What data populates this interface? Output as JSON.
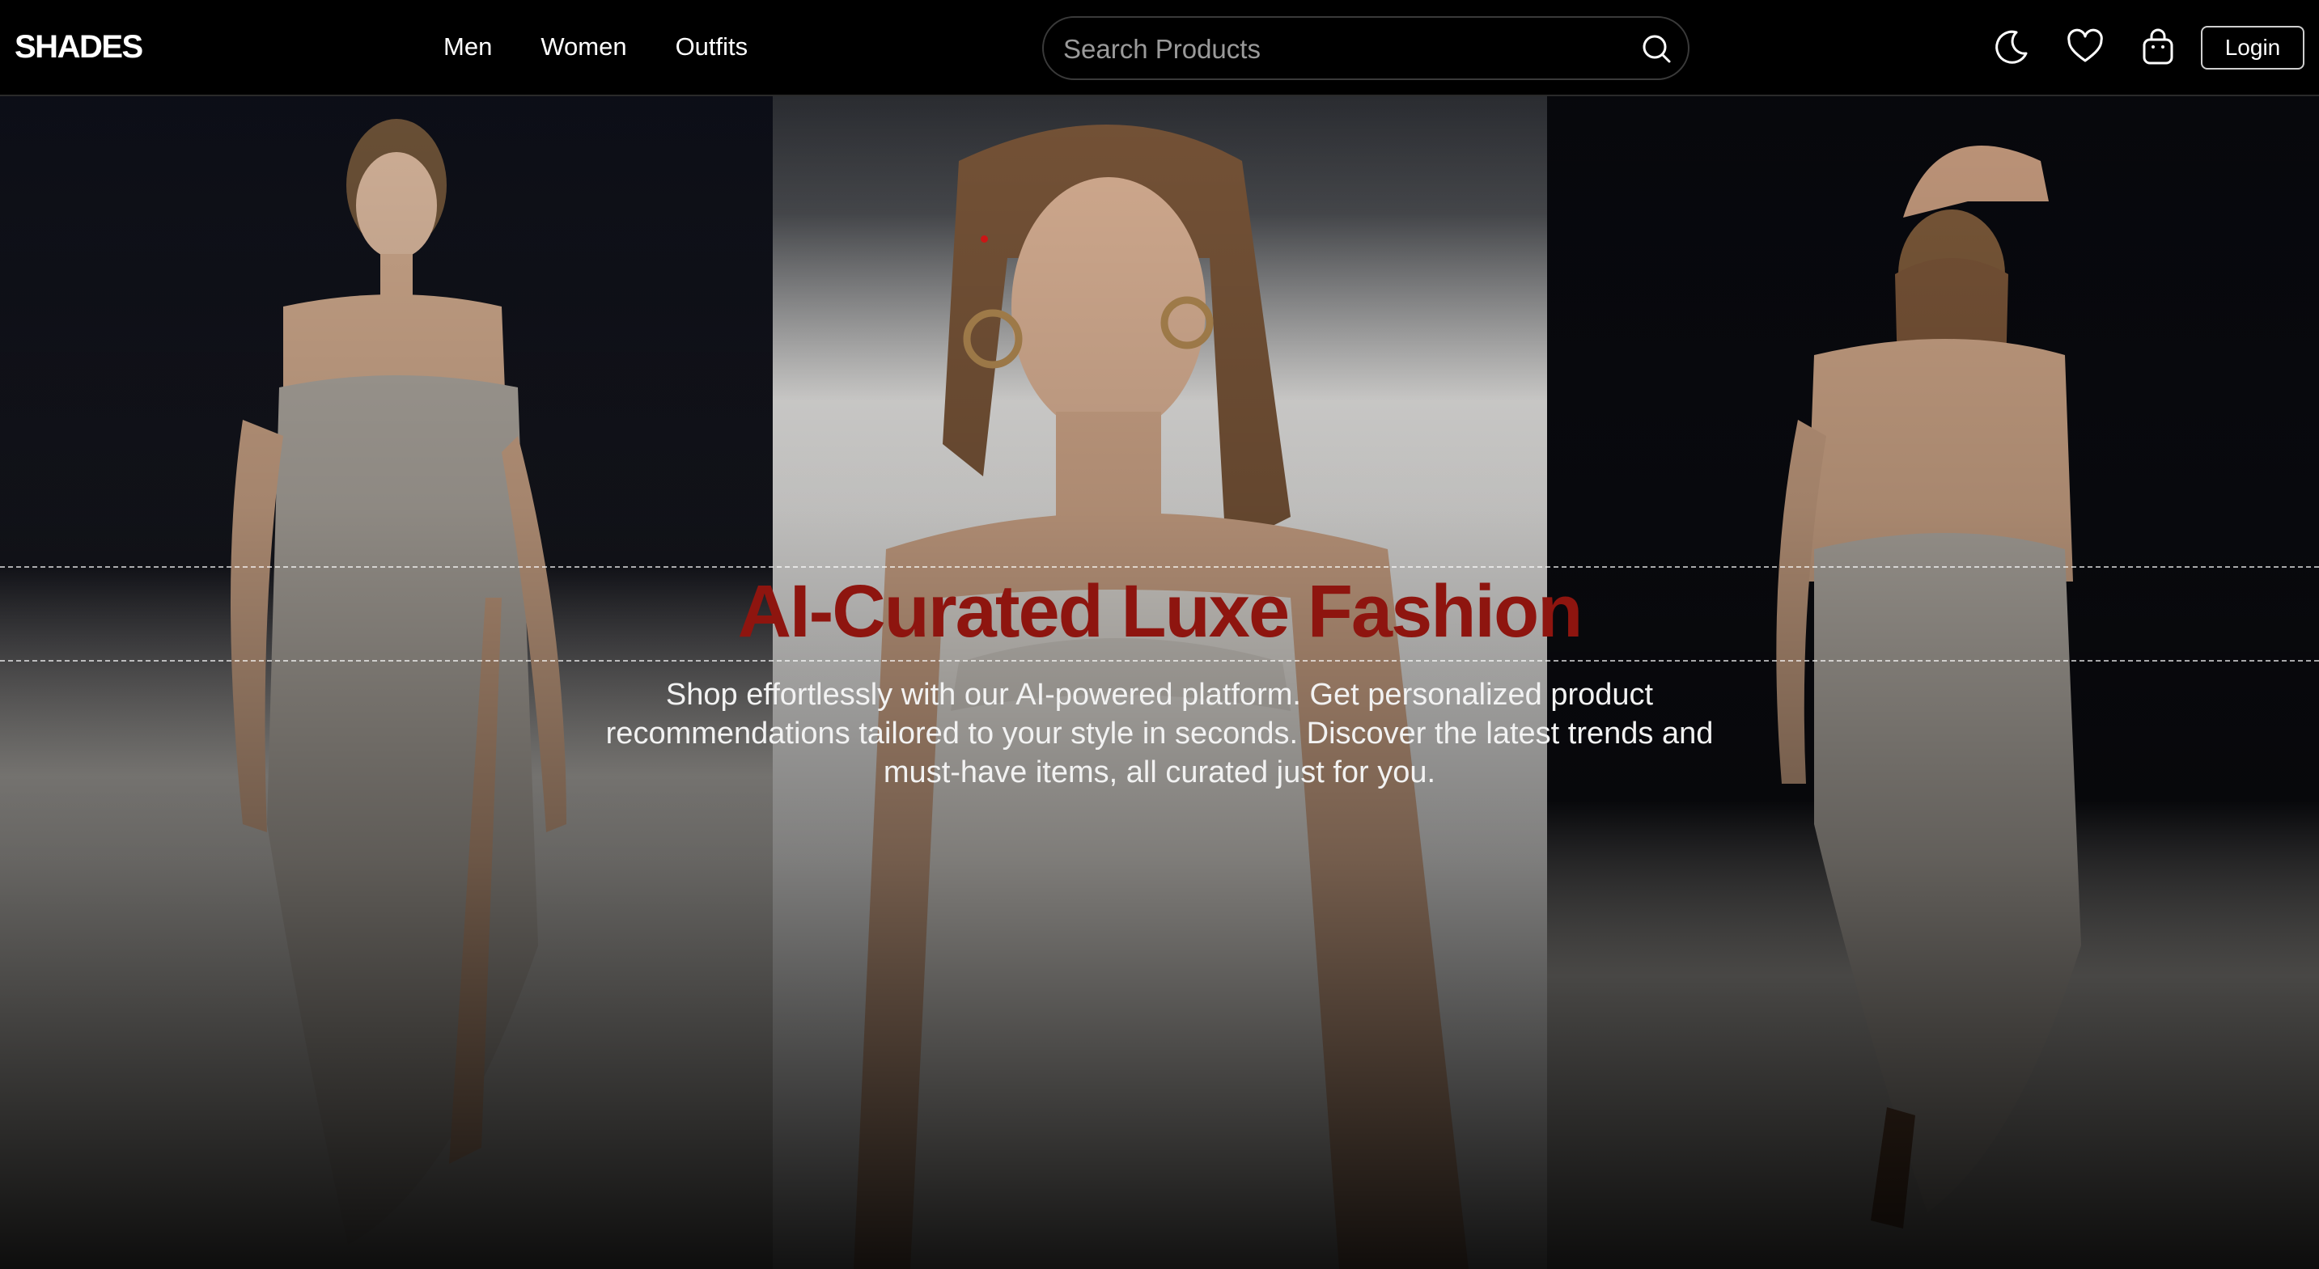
{
  "header": {
    "brand": "SHADES",
    "nav": [
      {
        "label": "Men"
      },
      {
        "label": "Women"
      },
      {
        "label": "Outfits"
      }
    ],
    "search": {
      "placeholder": "Search Products",
      "icon": "search-icon"
    },
    "icons": [
      "moon-icon",
      "heart-icon",
      "shopping-bag-icon"
    ],
    "login_label": "Login"
  },
  "hero": {
    "title": "AI-Curated Luxe Fashion",
    "subtitle": "Shop effortlessly with our AI-powered platform. Get personalized product recommendations tailored to your style in seconds. Discover the latest trends and must-have items, all curated just for you.",
    "images": [
      "runway-model-front-image",
      "runway-model-closeup-image",
      "runway-model-back-image"
    ]
  },
  "colors": {
    "background": "#000000",
    "title": "#8e150f",
    "text": "#ffffff",
    "placeholder": "#9a9a9a"
  }
}
